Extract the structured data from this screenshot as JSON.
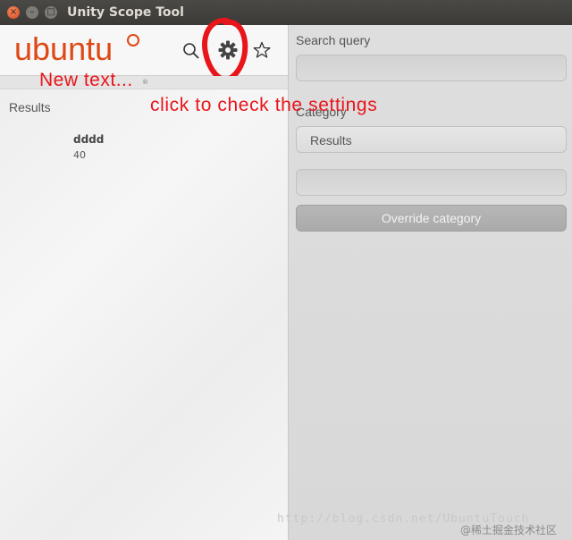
{
  "window": {
    "title": "Unity Scope Tool",
    "close_glyph": "×",
    "minimize_glyph": "–",
    "maximize_glyph": "□"
  },
  "dash": {
    "logo": "ubuntu",
    "icons": [
      "search-icon",
      "gear-icon",
      "star-icon"
    ],
    "results_label": "Results",
    "results": [
      {
        "title": "dddd",
        "subtitle": "40"
      }
    ]
  },
  "settings": {
    "search_query_label": "Search query",
    "search_query_value": "",
    "category_label": "Category",
    "category_value": "Results",
    "extra_field_value": "",
    "override_button": "Override category"
  },
  "annotations": {
    "new_text": "New text...",
    "instruction": "click to  check the settings",
    "color": "#e8151b"
  },
  "watermarks": {
    "url": "http://blog.csdn.net/UbuntuTouch",
    "site": "@稀土掘金技术社区"
  },
  "colors": {
    "ubuntu_orange": "#dd4814",
    "titlebar": "#3b3a37"
  }
}
